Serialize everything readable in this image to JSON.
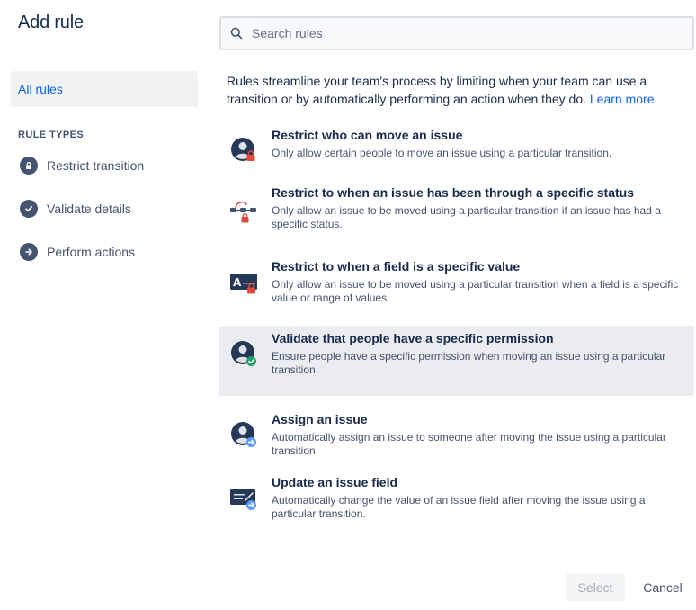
{
  "dialog": {
    "title": "Add rule"
  },
  "sidebar": {
    "all_rules": "All rules",
    "section_heading": "RULE TYPES",
    "items": [
      {
        "label": "Restrict transition",
        "icon": "lock-icon"
      },
      {
        "label": "Validate details",
        "icon": "check-icon"
      },
      {
        "label": "Perform actions",
        "icon": "arrow-right-icon"
      }
    ]
  },
  "search": {
    "placeholder": "Search rules",
    "value": ""
  },
  "intro": {
    "text": "Rules streamline your team's process by limiting when your team can use a transition or by automatically performing an action when they do. ",
    "link": "Learn more."
  },
  "rules": [
    {
      "title": "Restrict who can move an issue",
      "desc": "Only allow certain people to move an issue using a particular transition.",
      "icon": "user-lock-icon"
    },
    {
      "title": "Restrict to when an issue has been through a specific status",
      "desc": "Only allow an issue to be moved using a particular transition if an issue has had a specific status.",
      "icon": "workflow-lock-icon"
    },
    {
      "title": "Restrict to when a field is a specific value",
      "desc": "Only allow an issue to be moved using a particular transition when a field is a specific value or range of values.",
      "icon": "field-lock-icon"
    },
    {
      "title": "Validate that people have a specific permission",
      "desc": "Ensure people have a specific permission when moving an issue using a particular transition.",
      "icon": "user-check-icon"
    },
    {
      "title": "Assign an issue",
      "desc": "Automatically assign an issue to someone after moving the issue using a particular transition.",
      "icon": "user-arrow-icon"
    },
    {
      "title": "Update an issue field",
      "desc": "Automatically change the value of an issue field after moving the issue using a particular transition.",
      "icon": "field-arrow-icon"
    }
  ],
  "footer": {
    "select_label": "Select",
    "cancel_label": "Cancel"
  },
  "colors": {
    "link": "#0c66e4",
    "lock_red": "#e2483d",
    "check_green": "#22a06b",
    "arrow_blue": "#579dff",
    "icon_dark": "#44546f"
  }
}
